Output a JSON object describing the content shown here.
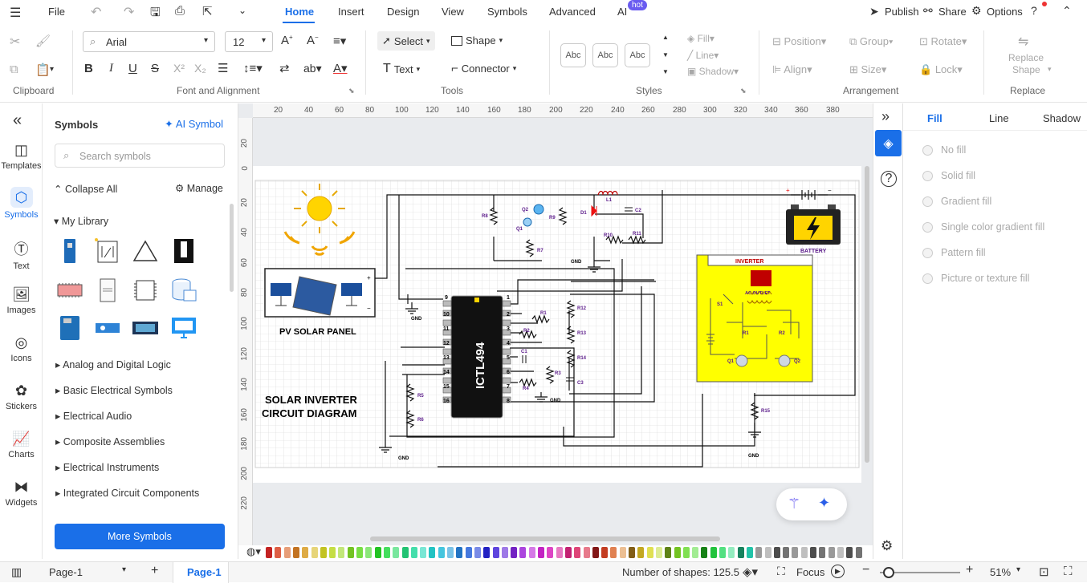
{
  "menu": {
    "file": "File",
    "tabs": [
      "Home",
      "Insert",
      "Design",
      "View",
      "Symbols",
      "Advanced",
      "AI"
    ],
    "ai_badge": "hot",
    "publish": "Publish",
    "share": "Share",
    "options": "Options"
  },
  "ribbon": {
    "clipboard_label": "Clipboard",
    "font_name": "Arial",
    "font_size": "12",
    "font_group_label": "Font and Alignment",
    "select": "Select",
    "shape": "Shape",
    "text": "Text",
    "connector": "Connector",
    "tools_label": "Tools",
    "style_samples": [
      "Abc",
      "Abc",
      "Abc"
    ],
    "styles_label": "Styles",
    "fill": "Fill",
    "line": "Line",
    "shadow": "Shadow",
    "position": "Position",
    "group": "Group",
    "rotate": "Rotate",
    "align": "Align",
    "size": "Size",
    "lock": "Lock",
    "arrangement_label": "Arrangement",
    "replace_shape_1": "Replace",
    "replace_shape_2": "Shape",
    "replace_label": "Replace"
  },
  "rail": [
    {
      "label": "Templates",
      "icon": "templates-icon"
    },
    {
      "label": "Symbols",
      "icon": "symbols-icon"
    },
    {
      "label": "Text",
      "icon": "text-icon"
    },
    {
      "label": "Images",
      "icon": "images-icon"
    },
    {
      "label": "Icons",
      "icon": "icons-icon"
    },
    {
      "label": "Stickers",
      "icon": "stickers-icon"
    },
    {
      "label": "Charts",
      "icon": "charts-icon"
    },
    {
      "label": "Widgets",
      "icon": "widgets-icon"
    }
  ],
  "library": {
    "title": "Symbols",
    "ai_symbol": "AI Symbol",
    "search_placeholder": "Search symbols",
    "collapse_all": "Collapse All",
    "manage": "Manage",
    "my_library": "My Library",
    "categories": [
      "Analog and Digital Logic",
      "Basic Electrical Symbols",
      "Electrical Audio",
      "Composite Assemblies",
      "Electrical Instruments",
      "Integrated Circuit Components"
    ],
    "more_symbols": "More Symbols"
  },
  "ruler": {
    "top_ticks": [
      "20",
      "40",
      "60",
      "80",
      "100",
      "120",
      "140",
      "160",
      "180",
      "200",
      "220",
      "240",
      "260",
      "280",
      "300",
      "320",
      "340",
      "360",
      "380"
    ],
    "left_ticks": [
      "20",
      "0",
      "20",
      "40",
      "60",
      "80",
      "100",
      "120",
      "140",
      "160",
      "180",
      "200",
      "220"
    ]
  },
  "diagram": {
    "title_line1": "SOLAR INVERTER",
    "title_line2": "CIRCUIT DIAGRAM",
    "pv_label": "PV SOLAR PANEL",
    "battery_label": "BATTERY",
    "inverter_label": "INVERTER",
    "ac_outlet": "AC OUTLET",
    "ic_label": "ICTL494",
    "gnd": "GND",
    "components": [
      "R8",
      "Q2",
      "Q1",
      "R9",
      "R7",
      "D1",
      "L1",
      "C2",
      "R10",
      "R11",
      "R1",
      "R2",
      "R12",
      "R13",
      "R14",
      "C1",
      "R3",
      "R4",
      "C3",
      "R5",
      "R6",
      "R15",
      "S1",
      "Q1",
      "Q2",
      "R1",
      "R2"
    ],
    "pins_left": [
      "9",
      "10",
      "11",
      "12",
      "13",
      "14",
      "15",
      "16"
    ],
    "pins_right": [
      "1",
      "2",
      "3",
      "4",
      "5",
      "6",
      "7",
      "8"
    ]
  },
  "right_panel": {
    "tabs": [
      "Fill",
      "Line",
      "Shadow"
    ],
    "options": [
      "No fill",
      "Solid fill",
      "Gradient fill",
      "Single color gradient fill",
      "Pattern fill",
      "Picture or texture fill"
    ]
  },
  "status": {
    "page_select": "Page-1",
    "page_tab": "Page-1",
    "shapes": "Number of shapes: 125.5",
    "focus": "Focus",
    "zoom": "51%"
  },
  "colors": {
    "accent": "#1a6fe8",
    "inverter_fill": "#ffff00",
    "ic_body": "#111111",
    "sun": "#ffd400"
  }
}
